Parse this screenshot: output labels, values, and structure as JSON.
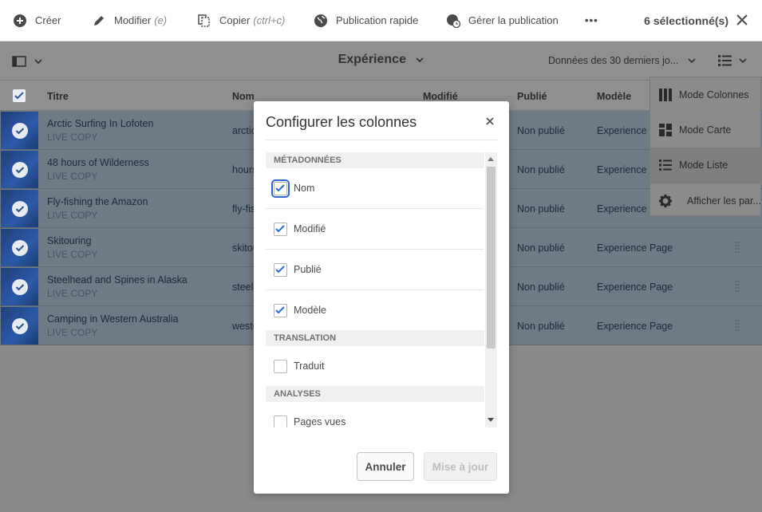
{
  "actionbar": {
    "create": "Créer",
    "edit": "Modifier",
    "edit_hint": "(e)",
    "copy": "Copier",
    "copy_hint": "(ctrl+c)",
    "quick_publish": "Publication rapide",
    "manage_publication": "Gérer la publication",
    "more": "•••",
    "selected": "6 sélectionné(s)"
  },
  "header": {
    "title": "Expérience",
    "date_range": "Données des 30 derniers jo..."
  },
  "columns": {
    "title": "Titre",
    "name": "Nom",
    "modified": "Modifié",
    "published": "Publié",
    "template": "Modèle"
  },
  "rows": [
    {
      "title": "Arctic Surfing In Lofoten",
      "sub": "LIVE COPY",
      "name": "arctic",
      "published": "Non publié",
      "template": "Experience P"
    },
    {
      "title": "48 hours of Wilderness",
      "sub": "LIVE COPY",
      "name": "hours",
      "published": "Non publié",
      "template": "Experience P"
    },
    {
      "title": "Fly-fishing the Amazon",
      "sub": "LIVE COPY",
      "name": "fly-fis",
      "published": "Non publié",
      "template": "Experience P"
    },
    {
      "title": "Skitouring",
      "sub": "LIVE COPY",
      "name": "skitou",
      "published": "Non publié",
      "template": "Experience Page"
    },
    {
      "title": "Steelhead and Spines in Alaska",
      "sub": "LIVE COPY",
      "name": "steell",
      "published": "Non publié",
      "template": "Experience Page"
    },
    {
      "title": "Camping in Western Australia",
      "sub": "LIVE COPY",
      "name": "weste",
      "published": "Non publié",
      "template": "Experience Page"
    }
  ],
  "view_menu": {
    "columns": "Mode Colonnes",
    "card": "Mode Carte",
    "list": "Mode Liste",
    "settings": "Afficher les par..."
  },
  "modal": {
    "title": "Configurer les colonnes",
    "sections": [
      {
        "label": "MÉTADONNÉES"
      },
      {
        "label": "TRANSLATION"
      },
      {
        "label": "ANALYSES"
      }
    ],
    "options": [
      {
        "label": "Nom",
        "checked": true
      },
      {
        "label": "Modifié",
        "checked": true
      },
      {
        "label": "Publié",
        "checked": true
      },
      {
        "label": "Modèle",
        "checked": true
      },
      {
        "label": "Traduit",
        "checked": false
      },
      {
        "label": "Pages vues",
        "checked": false
      }
    ],
    "cancel": "Annuler",
    "update": "Mise à jour"
  },
  "colors": {
    "accent": "#2b6bd6",
    "overlay": "#8f8f8f",
    "selected_row": "#6e7a86"
  }
}
